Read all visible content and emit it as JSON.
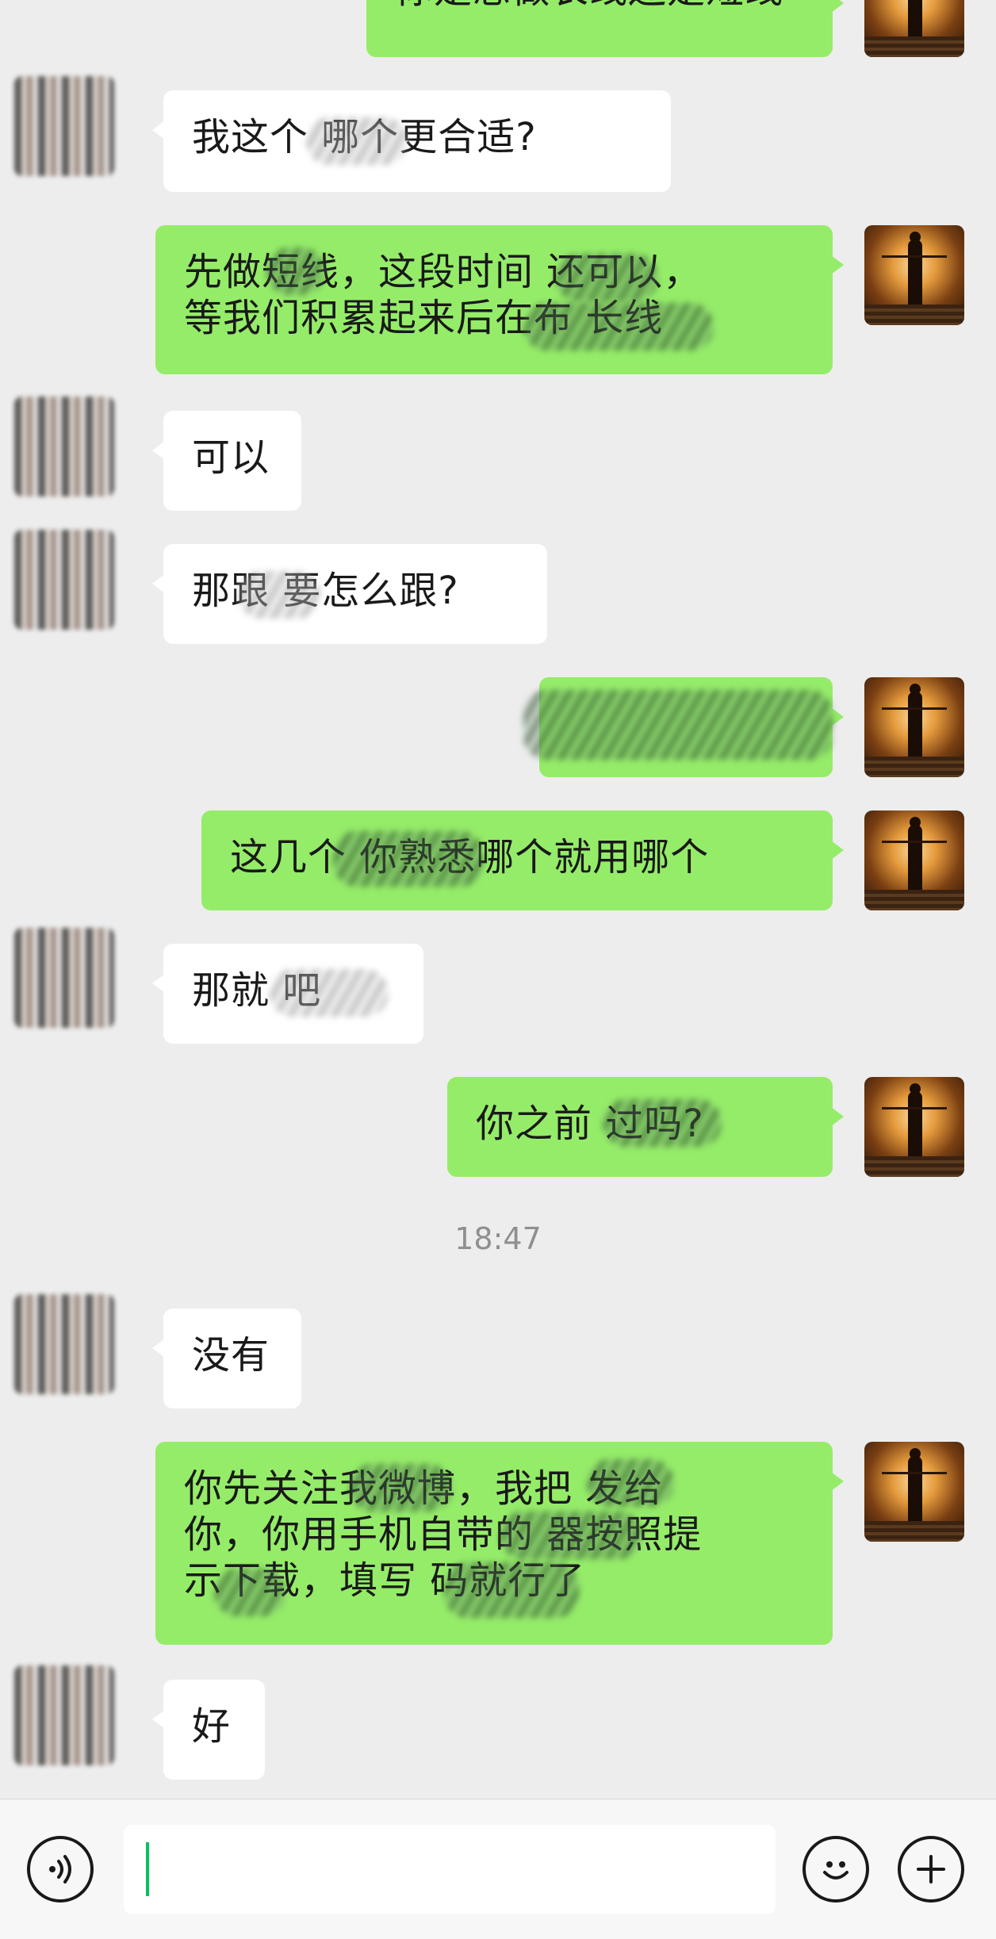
{
  "messages": [
    {
      "side": "mine",
      "text": "你是想做长线还是短线"
    },
    {
      "side": "theirs",
      "text": "我这个    哪个更合适?"
    },
    {
      "side": "mine",
      "line1": "先做短线，这段时间    还可以，",
      "line2": "等我们积累起来后在布  长线"
    },
    {
      "side": "theirs",
      "text": "可以"
    },
    {
      "side": "theirs",
      "text": "那跟    要怎么跟?"
    },
    {
      "side": "mine",
      "text": "  "
    },
    {
      "side": "mine",
      "text": "这几个    你熟悉哪个就用哪个"
    },
    {
      "side": "theirs",
      "text": "那就    吧"
    },
    {
      "side": "mine",
      "text": "你之前    过吗?"
    },
    {
      "side": "theirs",
      "text": "没有"
    },
    {
      "side": "mine",
      "line1": "你先关注我微博，我把    发给",
      "line2": "你，你用手机自带的    器按照提",
      "line3": "示下载，填写    码就行了"
    },
    {
      "side": "theirs",
      "text": "好"
    }
  ],
  "timestamp": "18:47",
  "input": {
    "value": ""
  },
  "icons": {
    "voice": "voice-icon",
    "emoji": "emoji-icon",
    "plus": "plus-icon"
  },
  "colors": {
    "mine_bubble": "#95ec69",
    "theirs_bubble": "#ffffff",
    "background": "#ededed",
    "caret": "#07c160"
  }
}
